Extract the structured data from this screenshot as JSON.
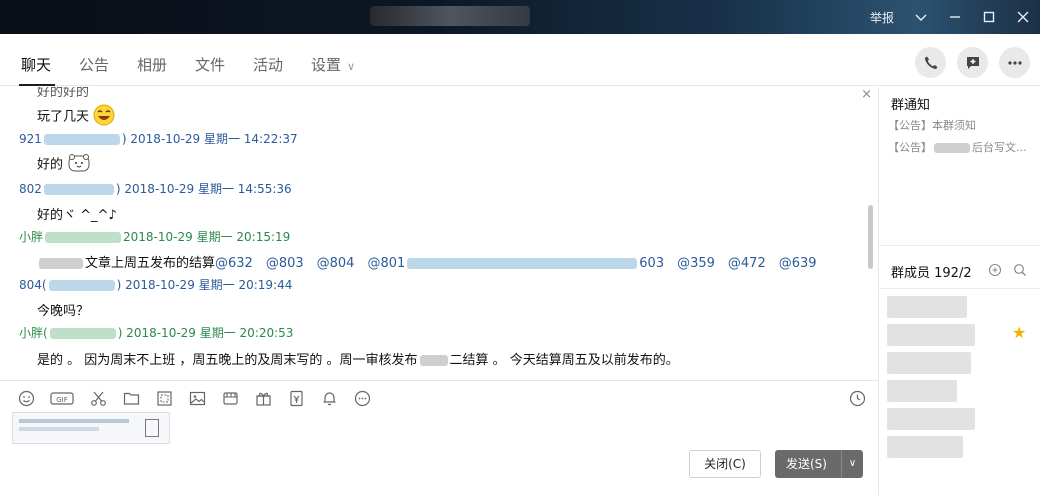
{
  "titlebar": {
    "report_label": "举报"
  },
  "tabs": [
    {
      "label": "聊天",
      "active": true
    },
    {
      "label": "公告"
    },
    {
      "label": "相册"
    },
    {
      "label": "文件"
    },
    {
      "label": "活动"
    },
    {
      "label": "设置"
    }
  ],
  "messages": {
    "m0_text": "好的好的",
    "m1_text": "玩了几天",
    "m2_head_prefix": "921",
    "m2_head_suffix": ") 2018-10-29 星期一 14:22:37",
    "m2_text": "好的",
    "m3_head_prefix": "802",
    "m3_head_suffix": ") 2018-10-29 星期一 14:55:36",
    "m3_text": "好的ヾ ^_^♪",
    "m4_head_prefix": "小胖",
    "m4_head_suffix": "2018-10-29 星期一 20:15:19",
    "m4_text": "文章上周五发布的结算",
    "m4_mentions_a": "@632　@803　@804　@801",
    "m4_mentions_b": "603　@359　@472　@639",
    "m5_head_prefix": "804(",
    "m5_head_suffix": ") 2018-10-29 星期一 20:19:44",
    "m5_text": "今晚吗？",
    "m6_head_prefix": "小胖(",
    "m6_head_suffix": ") 2018-10-29 星期一 20:20:53",
    "m6_text_a": "是的 。 因为周末不上班 ，周五晚上的及周末写的 。周一审核发布",
    "m6_text_b": "二结算 。 今天结算周五及以前发布的。"
  },
  "input": {
    "close_label": "关闭(C)",
    "send_label": "发送(S)"
  },
  "sidebar": {
    "notice_title": "群通知",
    "notice_1": "【公告】本群须知",
    "notice_2_prefix": "【公告】",
    "notice_2_suffix": "后台写文...",
    "members_title": "群成员 192/2"
  }
}
